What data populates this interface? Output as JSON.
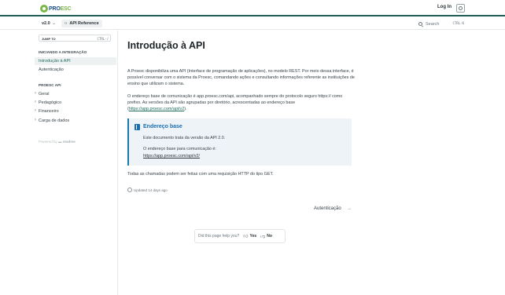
{
  "header": {
    "logo_text_main": "PRO",
    "logo_text_accent": "ESC",
    "login_label": "Log In",
    "theme_icon": "theme-toggle-icon"
  },
  "subnav": {
    "version": "v2.0",
    "tab_label": "API Reference",
    "search_placeholder": "Search",
    "search_shortcut": "CTRL-K"
  },
  "sidebar": {
    "jump_label": "JUMP TO",
    "jump_shortcut": "CTRL-/",
    "sections": [
      {
        "title": "INICIANDO A INTEGRAÇÃO",
        "items": [
          {
            "label": "Introdução à API",
            "active": true
          },
          {
            "label": "Autenticação",
            "active": false
          }
        ]
      },
      {
        "title": "PROESC API",
        "items": [
          {
            "label": "Geral"
          },
          {
            "label": "Pedagógico"
          },
          {
            "label": "Financeiro"
          },
          {
            "label": "Carga de dados"
          }
        ]
      }
    ],
    "powered_prefix": "Powered by",
    "powered_brand": "readme"
  },
  "main": {
    "title": "Introdução à API",
    "para1": "A Proesc disponibiliza uma API (Interface de programação de aplicações), no modelo REST. Por meio dessa interface, é possível conversar com o sistema da Proesc, comandando ações e consultando informações referente as instituições de ensino que utilizam o sistema.",
    "para2_text": "O endereço base de comunicação é app.proesc.com/api, acompanhado sempre do protocolo seguro https:// como prefixo. As versões da API são agrupadas por diretório, acrescentadas ao endereço base (",
    "para2_link": "https://app.proesc.com/api/v2",
    "para2_end": ").",
    "callout": {
      "title": "Endereço base",
      "line1": "Este documento trata da versão da API 2.0.",
      "line2": "O endereço base para comunicação é:",
      "link": "https://app.proesc.com/api/v2/"
    },
    "para3": "Todas as chamadas podem ser feitas com uma requisição HTTP do tipo GET.",
    "updated": "Updated 14 days ago",
    "next_label": "Autenticação",
    "feedback": {
      "question": "Did this page help you?",
      "yes": "Yes",
      "no": "No"
    }
  }
}
